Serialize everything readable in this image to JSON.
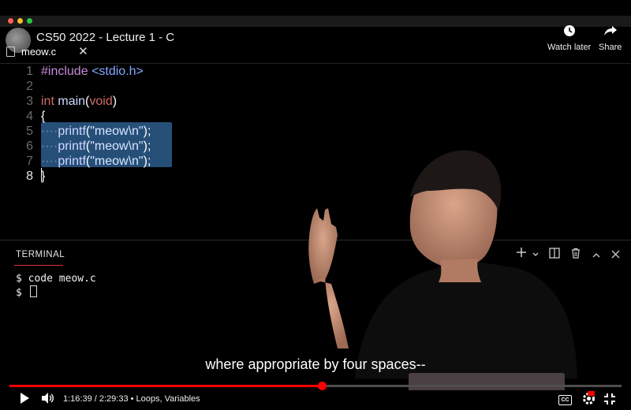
{
  "window": {
    "mac_dots": [
      "#ff5f57",
      "#febc2e",
      "#28c840"
    ]
  },
  "video": {
    "title": "CS50 2022 - Lecture 1 - C",
    "actions": [
      {
        "name": "watch-later",
        "label": "Watch later",
        "icon": "clock-icon"
      },
      {
        "name": "share",
        "label": "Share",
        "icon": "share-icon"
      }
    ],
    "subtitle": "where appropriate by four spaces--"
  },
  "editor": {
    "tab_label": "meow.c",
    "close_glyph": "✕",
    "lines": [
      {
        "n": "1",
        "text": "#include <stdio.h>"
      },
      {
        "n": "2",
        "text": ""
      },
      {
        "n": "3",
        "text": "int main(void)"
      },
      {
        "n": "4",
        "text": "{"
      },
      {
        "n": "5",
        "text": "····printf(\"meow\\n\");"
      },
      {
        "n": "6",
        "text": "····printf(\"meow\\n\");"
      },
      {
        "n": "7",
        "text": "····printf(\"meow\\n\");"
      },
      {
        "n": "8",
        "text": "}"
      }
    ],
    "active_line": "8"
  },
  "terminal": {
    "label": "TERMINAL",
    "lines": [
      "$ code meow.c",
      "$ "
    ],
    "tools": [
      "plus-icon",
      "chevron-down-icon",
      "split-icon",
      "trash-icon",
      "chevron-up-icon",
      "close-icon"
    ]
  },
  "player": {
    "time": "1:16:39 / 2:29:33 • Loops, Variables",
    "progress": 0.51,
    "accent": "#ff0000",
    "icons": [
      "play-icon",
      "volume-icon",
      "captions-icon",
      "settings-icon",
      "exit-fullscreen-icon"
    ]
  }
}
